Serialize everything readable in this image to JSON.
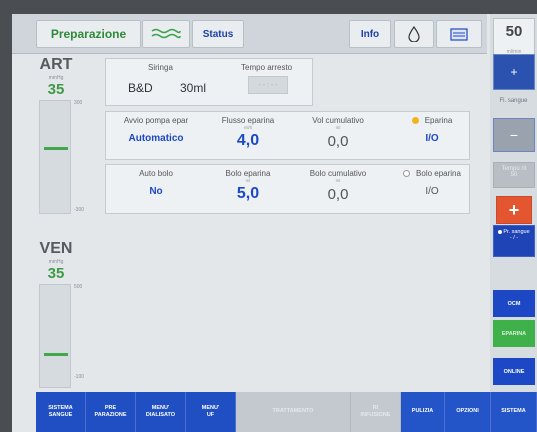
{
  "topbar": {
    "preparazione": "Preparazione",
    "wave_icon": "wave-icon",
    "status": "Status",
    "info": "Info",
    "drop_icon": "drop-icon",
    "folder_icon": "folder-icon"
  },
  "right_panel": {
    "top_value": "50",
    "top_unit": "ml/min",
    "plus": "+",
    "flow_label": "Fl. sangue",
    "minus": "−",
    "tempo_label": "Tempo rit",
    "tempo_value": "50",
    "red_plus": "+",
    "pr_label": "Pr. sangue",
    "pr_value": "- / -",
    "ocm": "OCM",
    "eparina": "EPARINA",
    "online": "ONLINE"
  },
  "art": {
    "label": "ART",
    "unit": "mmHg",
    "value": "35",
    "scale_top": "300",
    "scale_bottom": "-300"
  },
  "ven": {
    "label": "VEN",
    "unit": "mmHg",
    "value": "35",
    "scale_top": "500",
    "scale_bottom": "-100"
  },
  "syringe": {
    "siringa_label": "Siringa",
    "brand": "B&D",
    "size": "30ml",
    "tempo_arresto_label": "Tempo arresto",
    "tempo_arresto_unit": "h:min",
    "tempo_arresto_value": "- - : - -"
  },
  "heparin": {
    "avvio_label": "Avvio pompa epar",
    "avvio_value": "Automatico",
    "flusso_label": "Flusso eparina",
    "flusso_unit": "ml/h",
    "flusso_value": "4,0",
    "vol_label": "Vol cumulativo",
    "vol_unit": "ml",
    "vol_value": "0,0",
    "eparina_label": "Eparina",
    "eparina_value": "I/O"
  },
  "bolo": {
    "auto_label": "Auto bolo",
    "auto_value": "No",
    "bolo_label": "Bolo eparina",
    "bolo_unit": "ml",
    "bolo_value": "5,0",
    "cumul_label": "Bolo cumulativo",
    "cumul_unit": "ml",
    "cumul_value": "0,0",
    "bolo_ep_label": "Bolo eparina",
    "bolo_ep_value": "I/O"
  },
  "bottom": {
    "b1": "SISTEMA\nSANGUE",
    "b2": "PRE\nPARAZIONE",
    "b3": "MENU'\nDIALISATO",
    "b4": "MENU'\nUF",
    "b5": "TRATTAMENTO",
    "b6": "RI\nINFUSIONE",
    "b7": "PULIZIA",
    "b8": "OPZIONI",
    "b9": "SISTEMA"
  },
  "colors": {
    "accent_blue": "#1d48c5",
    "green": "#3f9a47",
    "red": "#e4562f",
    "yellow_indicator": "#f0b51d"
  }
}
